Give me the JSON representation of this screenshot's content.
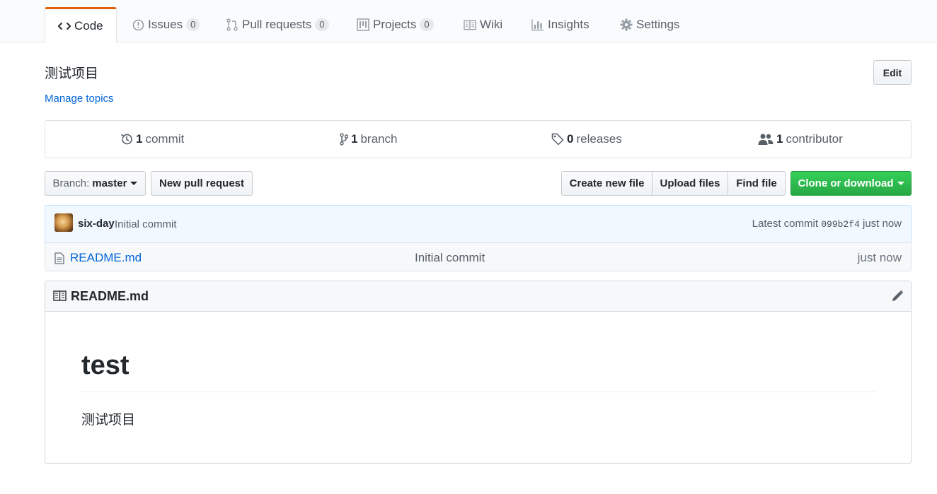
{
  "tabs": {
    "code": {
      "label": "Code"
    },
    "issues": {
      "label": "Issues",
      "count": "0"
    },
    "pulls": {
      "label": "Pull requests",
      "count": "0"
    },
    "projects": {
      "label": "Projects",
      "count": "0"
    },
    "wiki": {
      "label": "Wiki"
    },
    "insights": {
      "label": "Insights"
    },
    "settings": {
      "label": "Settings"
    },
    "selected": "Code",
    "accent_color": "#e36209"
  },
  "repo": {
    "description": "测试项目",
    "manage_topics": "Manage topics",
    "edit_label": "Edit"
  },
  "summary": {
    "commits": {
      "count": "1",
      "label": "commit"
    },
    "branches": {
      "count": "1",
      "label": "branch"
    },
    "releases": {
      "count": "0",
      "label": "releases"
    },
    "contributors": {
      "count": "1",
      "label": "contributor"
    }
  },
  "file_nav": {
    "branch_prefix": "Branch:",
    "branch_name": "master",
    "new_pull_request": "New pull request",
    "create_new_file": "Create new file",
    "upload_files": "Upload files",
    "find_file": "Find file",
    "clone_or_download": "Clone or download",
    "clone_color": "#28a745"
  },
  "latest_commit": {
    "author": "six-day",
    "message": "Initial commit",
    "prefix": "Latest commit",
    "sha": "099b2f4",
    "age": "just now"
  },
  "files": [
    {
      "name": "README.md",
      "message": "Initial commit",
      "age": "just now",
      "icon": "file-icon"
    }
  ],
  "readme": {
    "filename": "README.md",
    "heading": "test",
    "paragraph": "测试项目"
  }
}
